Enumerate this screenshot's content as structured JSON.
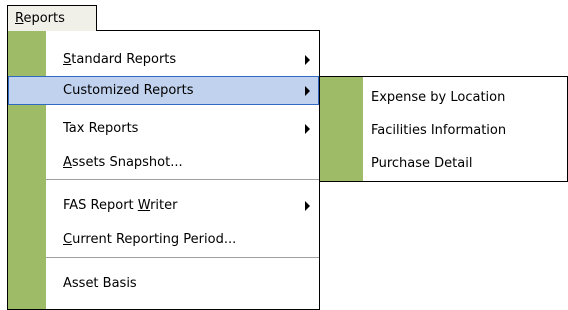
{
  "menubar": {
    "reports_menu": {
      "mnemonic": "R",
      "rest": "eports"
    }
  },
  "main_menu": {
    "items": [
      {
        "pre": "",
        "mn": "S",
        "post": "tandard Reports",
        "submenu": true
      },
      {
        "pre": "Customized Reports",
        "mn": "",
        "post": "",
        "submenu": true,
        "highlighted": true
      },
      {
        "pre": "Tax Reports",
        "mn": "",
        "post": "",
        "submenu": true
      },
      {
        "pre": "",
        "mn": "A",
        "post": "ssets Snapshot...",
        "submenu": false
      },
      {
        "pre": "FAS Report ",
        "mn": "W",
        "post": "riter",
        "submenu": true
      },
      {
        "pre": "",
        "mn": "C",
        "post": "urrent Reporting Period...",
        "submenu": false
      },
      {
        "pre": "Asset Basis",
        "mn": "",
        "post": "",
        "submenu": false
      }
    ]
  },
  "submenu_customized_reports": {
    "items": [
      {
        "label": "Expense by Location"
      },
      {
        "label": "Facilities Information"
      },
      {
        "label": "Purchase Detail"
      }
    ]
  },
  "colors": {
    "gutter": "#9ebc67",
    "highlight_fill": "#c1d2ee",
    "highlight_border": "#316ac5",
    "menubar_bg": "#f1f0e8"
  }
}
